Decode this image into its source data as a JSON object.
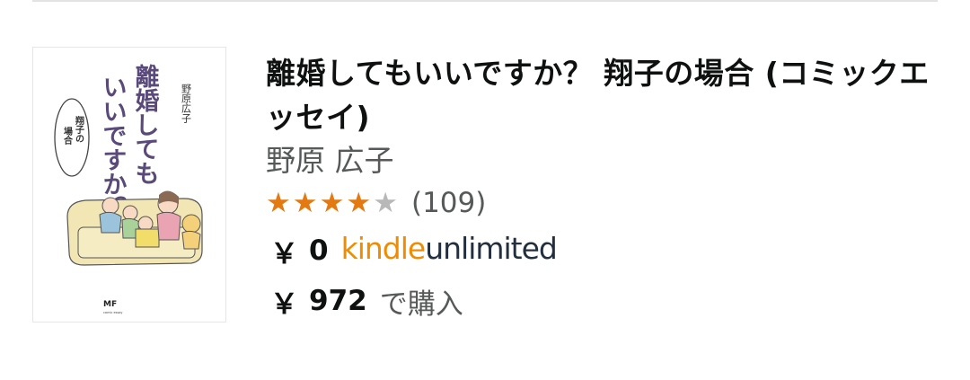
{
  "book": {
    "title": "離婚してもいいですか？ 翔子の場合 (コミックエッセイ)",
    "author": "野原 広子",
    "rating": 4,
    "rating_max": 5,
    "review_count": "(109)",
    "ku_price": {
      "currency": "￥",
      "amount": "0"
    },
    "ku_logo": {
      "kindle": "kindle",
      "unlimited": "unlimited"
    },
    "purchase_price": {
      "currency": "￥",
      "amount": "972",
      "suffix": "で購入"
    },
    "cover": {
      "author_vertical": "野原広子",
      "title_line1": "離婚しても",
      "title_line2": "いいですか？",
      "subtitle_line1": "翔子の",
      "subtitle_line2": "場合",
      "publisher_mark": "MF",
      "publisher_sub": "comic essay"
    }
  },
  "colors": {
    "star_full": "#e47911",
    "star_empty": "#b8b8b8",
    "kindle_orange": "#f08c00",
    "unlimited_navy": "#232f3e"
  }
}
